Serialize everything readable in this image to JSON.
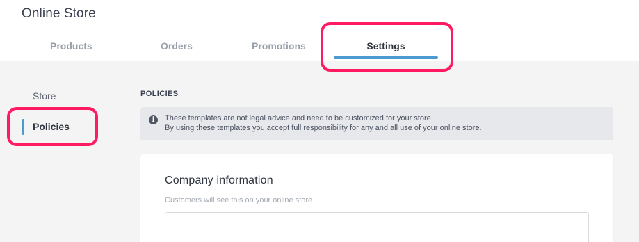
{
  "app": {
    "title": "Online Store"
  },
  "tabs": [
    {
      "label": "Products",
      "active": false
    },
    {
      "label": "Orders",
      "active": false
    },
    {
      "label": "Promotions",
      "active": false
    },
    {
      "label": "Settings",
      "active": true
    }
  ],
  "sidebar": {
    "items": [
      {
        "label": "Store",
        "active": false
      },
      {
        "label": "Policies",
        "active": true
      }
    ]
  },
  "main": {
    "section_title": "POLICIES",
    "notice": {
      "icon": "info-icon",
      "line1": "These templates are not legal advice and need to be customized for your store.",
      "line2": "By using these templates you accept full responsibility for any and all use of your online store."
    },
    "card": {
      "title": "Company information",
      "subtitle": "Customers will see this on your online store",
      "input_value": ""
    }
  },
  "colors": {
    "accent": "#4b9bd1",
    "highlight": "#ff1a62",
    "background": "#f4f4f5"
  }
}
